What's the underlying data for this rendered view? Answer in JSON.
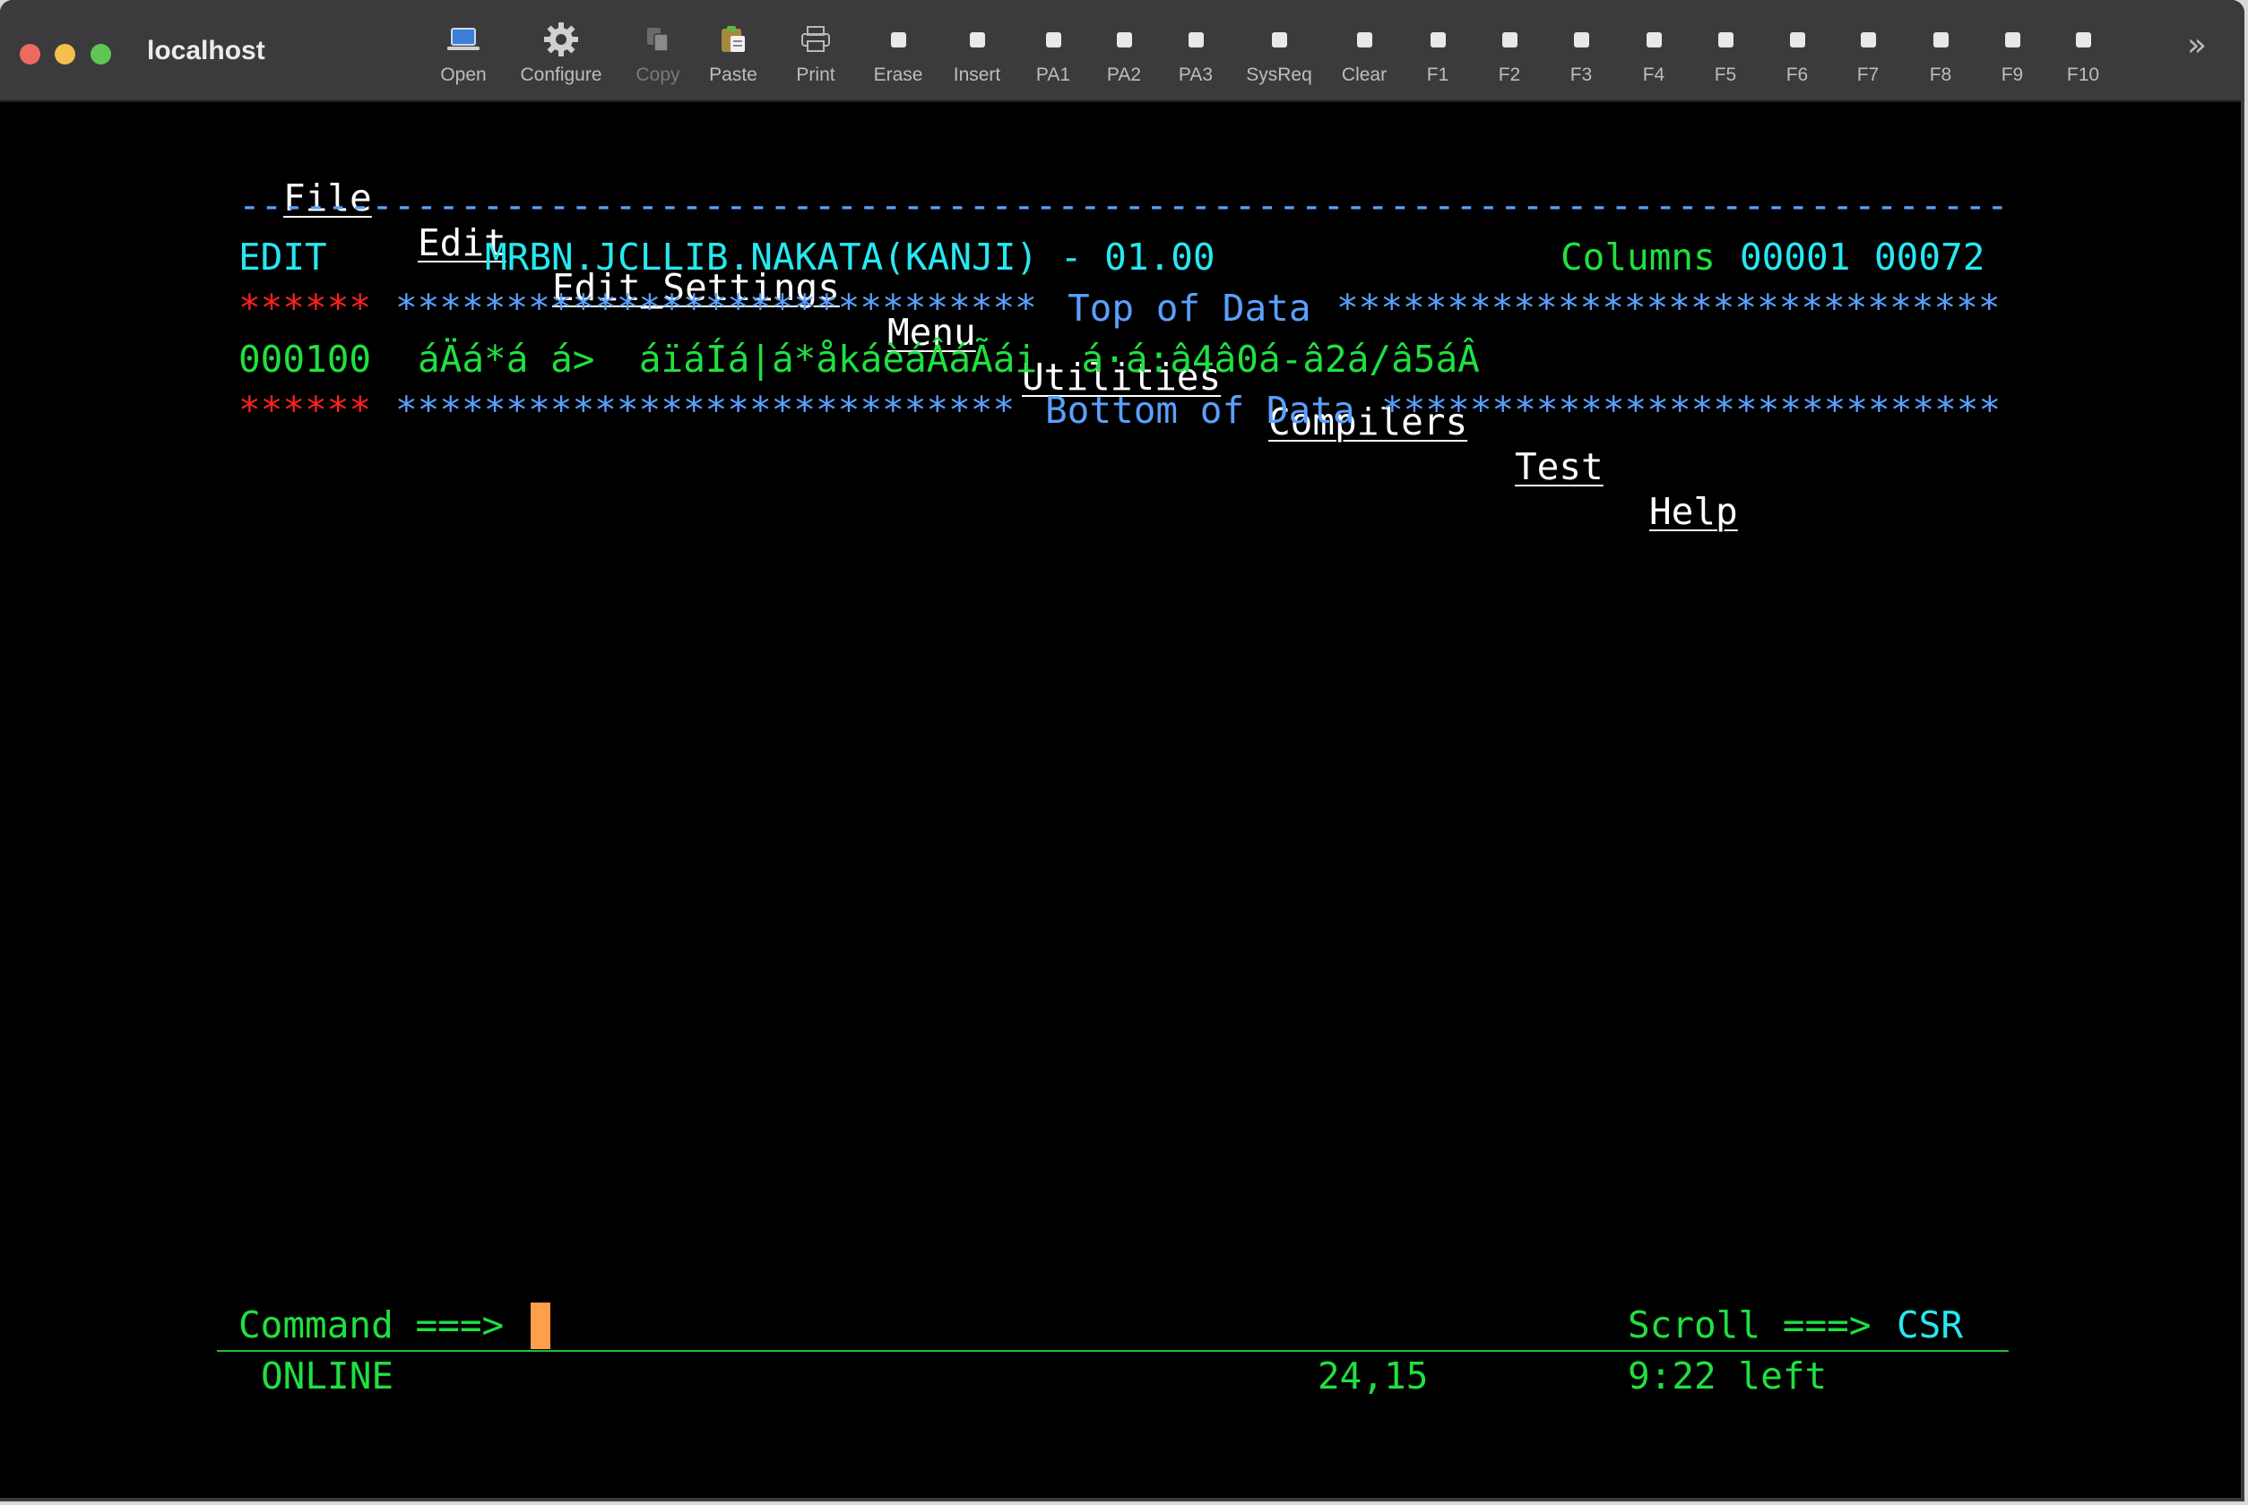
{
  "window": {
    "title": "localhost"
  },
  "toolbar": {
    "tools": [
      {
        "label": "Open",
        "icon": "laptop-icon"
      },
      {
        "label": "Configure",
        "icon": "gear-icon"
      },
      {
        "label": "Copy",
        "icon": "copy-icon"
      },
      {
        "label": "Paste",
        "icon": "paste-icon"
      },
      {
        "label": "Print",
        "icon": "printer-icon"
      },
      {
        "label": "Erase",
        "icon": "key-icon"
      },
      {
        "label": "Insert",
        "icon": "key-icon"
      },
      {
        "label": "PA1",
        "icon": "key-icon"
      },
      {
        "label": "PA2",
        "icon": "key-icon"
      },
      {
        "label": "PA3",
        "icon": "key-icon"
      },
      {
        "label": "SysReq",
        "icon": "key-icon"
      },
      {
        "label": "Clear",
        "icon": "key-icon"
      },
      {
        "label": "F1",
        "icon": "key-icon"
      },
      {
        "label": "F2",
        "icon": "key-icon"
      },
      {
        "label": "F3",
        "icon": "key-icon"
      },
      {
        "label": "F4",
        "icon": "key-icon"
      },
      {
        "label": "F5",
        "icon": "key-icon"
      },
      {
        "label": "F6",
        "icon": "key-icon"
      },
      {
        "label": "F7",
        "icon": "key-icon"
      },
      {
        "label": "F8",
        "icon": "key-icon"
      },
      {
        "label": "F9",
        "icon": "key-icon"
      },
      {
        "label": "F10",
        "icon": "key-icon"
      }
    ],
    "more_icon": "chevron-double-right-icon"
  },
  "terminal": {
    "menu": {
      "file": "File",
      "edit": "Edit",
      "edit_settings": "Edit_Settings",
      "menu": "Menu",
      "utilities": "Utilities",
      "compilers": "Compilers",
      "test": "Test",
      "help": "Help"
    },
    "separator": "--------------------------------------------------------------------------------",
    "header": {
      "mode": "EDIT",
      "dataset": "MRBN.JCLLIB.NAKATA(KANJI) - 01.00",
      "columns_label": "Columns",
      "col_start": "00001",
      "col_end": "00072"
    },
    "top_marker": {
      "prefix": "******",
      "stars_left": "*****************************",
      "text": "Top of Data",
      "stars_right": "******************************"
    },
    "data_line": {
      "number": "000100",
      "content": "áÄá*á á>  áïáÍá|á*åkáèáÂáÃái  á·á:â4â0á-â2á/â5áÂ"
    },
    "bottom_marker": {
      "prefix": "******",
      "stars_left": "****************************",
      "text": "Bottom of Data",
      "stars_right": "****************************"
    },
    "command": {
      "label": "Command ===>",
      "value": ""
    },
    "scroll": {
      "label": "Scroll ===>",
      "value": "CSR"
    },
    "status": {
      "state": "ONLINE",
      "position": "24,15",
      "time_left": "9:22 left"
    },
    "colors": {
      "background": "#000000",
      "cyan": "#27e8f0",
      "green": "#20e040",
      "blue": "#5aa0ff",
      "red": "#ff2020",
      "cursor": "#ff9f4a"
    }
  }
}
